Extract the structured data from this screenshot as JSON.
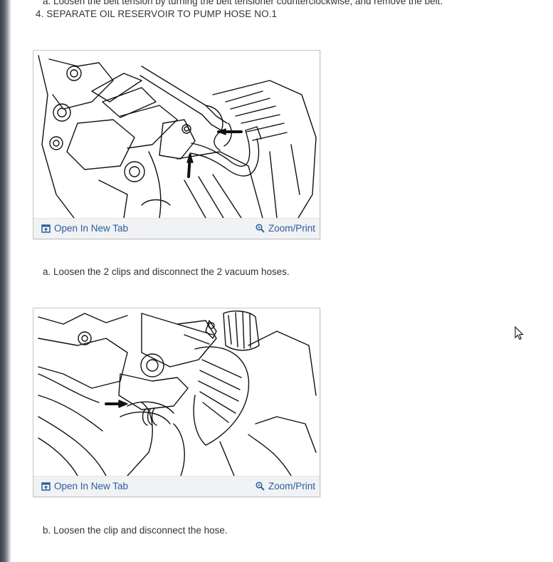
{
  "document": {
    "previous_step_text": "a. Loosen the belt tension by turning the belt tensioner counterclockwise, and remove the belt.",
    "step_heading": "4. SEPARATE OIL RESERVOIR TO PUMP HOSE NO.1",
    "figures": [
      {
        "open_label": "Open In New Tab",
        "zoom_label": "Zoom/Print",
        "caption": "a. Loosen the 2 clips and disconnect the 2 vacuum hoses."
      },
      {
        "open_label": "Open In New Tab",
        "zoom_label": "Zoom/Print",
        "caption": "b. Loosen the clip and disconnect the hose."
      }
    ]
  },
  "colors": {
    "link": "#2b5d9c",
    "text": "#333333",
    "figure_bar": "#f1f2f4",
    "figure_border": "#c4c4c4"
  },
  "icons": {
    "open": "open-in-new-tab-icon",
    "zoom": "zoom-magnifier-icon",
    "cursor": "mouse-pointer-icon"
  }
}
